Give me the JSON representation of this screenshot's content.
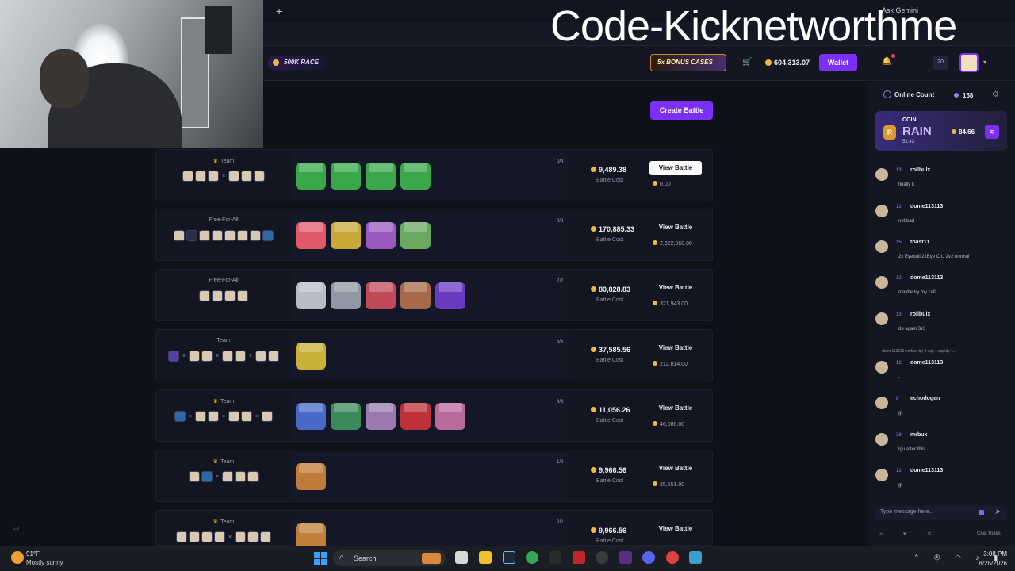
{
  "watermark": "Code-Kicknetworthme",
  "browser": {
    "new_tab": "+",
    "ask_gemini": "Ask Gemini"
  },
  "header": {
    "race_label": "500K RACE",
    "bonus_label": "5x BONUS CASES",
    "cart_icon": "cart-icon",
    "balance": "604,313.07",
    "wallet_label": "Wallet",
    "level": "20"
  },
  "main": {
    "create_battle_label": "Create Battle"
  },
  "battles": [
    {
      "mode": "Team",
      "crown": true,
      "count": "0/4",
      "cost": "9,489.38",
      "cost_label": "Battle Cost",
      "view_label": "View Battle",
      "prize": "0.00",
      "white": true
    },
    {
      "mode": "Free-For-All",
      "crown": false,
      "count": "0/8",
      "cost": "170,885.33",
      "cost_label": "Battle Cost",
      "view_label": "View Battle",
      "prize": "2,622,068.00",
      "white": false
    },
    {
      "mode": "Free-For-All",
      "crown": false,
      "count": "7/7",
      "cost": "80,828.83",
      "cost_label": "Battle Cost",
      "view_label": "View Battle",
      "prize": "321,943.00",
      "white": false
    },
    {
      "mode": "Team",
      "crown": false,
      "count": "5/5",
      "cost": "37,585.56",
      "cost_label": "Battle Cost",
      "view_label": "View Battle",
      "prize": "212,814.00",
      "white": false
    },
    {
      "mode": "Team",
      "crown": true,
      "count": "8/8",
      "cost": "11,056.26",
      "cost_label": "Battle Cost",
      "view_label": "View Battle",
      "prize": "46,086.00",
      "white": false
    },
    {
      "mode": "Team",
      "crown": true,
      "count": "1/2",
      "cost": "9,966.56",
      "cost_label": "Battle Cost",
      "view_label": "View Battle",
      "prize": "25,551.00",
      "white": false
    },
    {
      "mode": "Team",
      "crown": true,
      "count": "2/2",
      "cost": "9,966.56",
      "cost_label": "Battle Cost",
      "view_label": "View Battle",
      "prize": "",
      "white": false
    }
  ],
  "chat": {
    "online_label": "Online Count",
    "online_count": "158",
    "rain": {
      "badge": "R",
      "coin_label": "COIN",
      "rain_label": "RAIN",
      "timer": "51:43",
      "amount": "84.66"
    },
    "messages": [
      {
        "level": "13",
        "name": "rollbulx",
        "text": "finally k"
      },
      {
        "level": "12",
        "name": "dome113113",
        "text": "not bad"
      },
      {
        "level": "15",
        "name": "toast11",
        "text": "2x Eyeball 2xEye C U 2v2 normal"
      },
      {
        "level": "12",
        "name": "dome113113",
        "text": "maybe try my call"
      },
      {
        "level": "13",
        "name": "rollbulx",
        "text": "do again 3v3"
      },
      {
        "level": "12",
        "name": "dome113113",
        "text": "."
      },
      {
        "level": "8",
        "name": "echodogen",
        "text": "gl"
      },
      {
        "level": "38",
        "name": "mrbux",
        "text": "Igu after this"
      },
      {
        "level": "12",
        "name": "dome113113",
        "text": "gl"
      }
    ],
    "reply_text": "dome113113: mrbux try 2 ucp 1 squidy 1...",
    "input_placeholder": "Type message here...",
    "rules_label": "Chat Rules"
  },
  "taskbar": {
    "temp": "91°F",
    "condition": "Mostly sunny",
    "search_label": "Search",
    "time": "3:08 PM",
    "date": "8/26/2026"
  },
  "colors": {
    "accent": "#7b2ff7",
    "coin": "#f0b93a",
    "bg": "#0f1119"
  }
}
